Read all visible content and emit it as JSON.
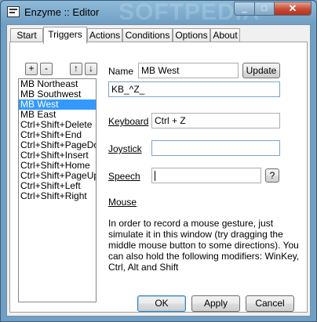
{
  "window": {
    "title": "Enzyme :: Editor",
    "watermark": "SOFTPEDIA",
    "minimize_glyph": "_",
    "maximize_glyph": "□",
    "close_glyph": "✕"
  },
  "tabs": [
    {
      "label": "Start",
      "active": false
    },
    {
      "label": "Triggers",
      "active": true
    },
    {
      "label": "Actions",
      "active": false
    },
    {
      "label": "Conditions",
      "active": false
    },
    {
      "label": "Options",
      "active": false
    },
    {
      "label": "About",
      "active": false
    }
  ],
  "toolbar": {
    "add_label": "+",
    "remove_label": "-",
    "up_label": "↑",
    "down_label": "↓"
  },
  "triggers": {
    "items": [
      "MB Northeast",
      "MB Southwest",
      "MB West",
      "MB East",
      "Ctrl+Shift+Delete",
      "Ctrl+Shift+End",
      "Ctrl+Shift+PageDow",
      "Ctrl+Shift+Insert",
      "Ctrl+Shift+Home",
      "Ctrl+Shift+PageUp",
      "Ctrl+Shift+Left",
      "Ctrl+Shift+Right"
    ],
    "selected_index": 2
  },
  "form": {
    "name_label": "Name",
    "name_value": "MB West",
    "update_label": "Update",
    "code_value": "KB_^Z_",
    "keyboard_label": "Keyboard",
    "keyboard_value": "Ctrl + Z",
    "joystick_label": "Joystick",
    "joystick_value": "",
    "speech_label": "Speech",
    "speech_value": "",
    "speech_help_label": "?",
    "mouse_label": "Mouse",
    "mouse_help": "In order to record a mouse gesture, just simulate it in this window (try dragging the middle mouse button to some directions). You can also hold the following modifiers: WinKey, Ctrl, Alt and Shift"
  },
  "footer": {
    "ok_label": "OK",
    "apply_label": "Apply",
    "cancel_label": "Cancel"
  }
}
